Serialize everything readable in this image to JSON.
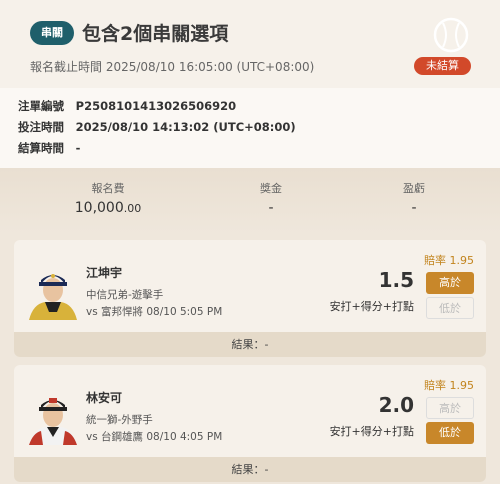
{
  "header": {
    "tag": "串關",
    "title": "包含2個串關選項",
    "deadline_label": "報名截止時間",
    "deadline_value": "2025/08/10 16:05:00 (UTC+08:00)",
    "status": "未結算",
    "status_color": "#d2492a"
  },
  "info": {
    "order_label": "注單編號",
    "order_value": "P2508101413026506920",
    "bet_time_label": "投注時間",
    "bet_time_value": "2025/08/10 14:13:02 (UTC+08:00)",
    "settle_label": "結算時間",
    "settle_value": "-"
  },
  "summary": {
    "fee_label": "報名費",
    "fee_main": "10,000",
    "fee_dec": ".00",
    "prize_label": "獎金",
    "prize_value": "-",
    "profit_label": "盈虧",
    "profit_value": "-"
  },
  "picks": [
    {
      "name": "江坤宇",
      "team": "中信兄弟-遊擊手",
      "game": "vs 富邦悍將 08/10 5:05 PM",
      "odds": "賠率 1.95",
      "line": "1.5",
      "stat": "安打+得分+打點",
      "over_label": "高於",
      "under_label": "低於",
      "selected": "over",
      "result": "結果：-",
      "icon": "player-photo"
    },
    {
      "name": "林安可",
      "team": "統一獅-外野手",
      "game": "vs 台鋼雄鷹 08/10 4:05 PM",
      "odds": "賠率 1.95",
      "line": "2.0",
      "stat": "安打+得分+打點",
      "over_label": "高於",
      "under_label": "低於",
      "selected": "under",
      "result": "結果：-",
      "icon": "player-photo"
    }
  ],
  "colors": {
    "accent": "#c8872a",
    "tag_bg": "#1f5f6b"
  }
}
